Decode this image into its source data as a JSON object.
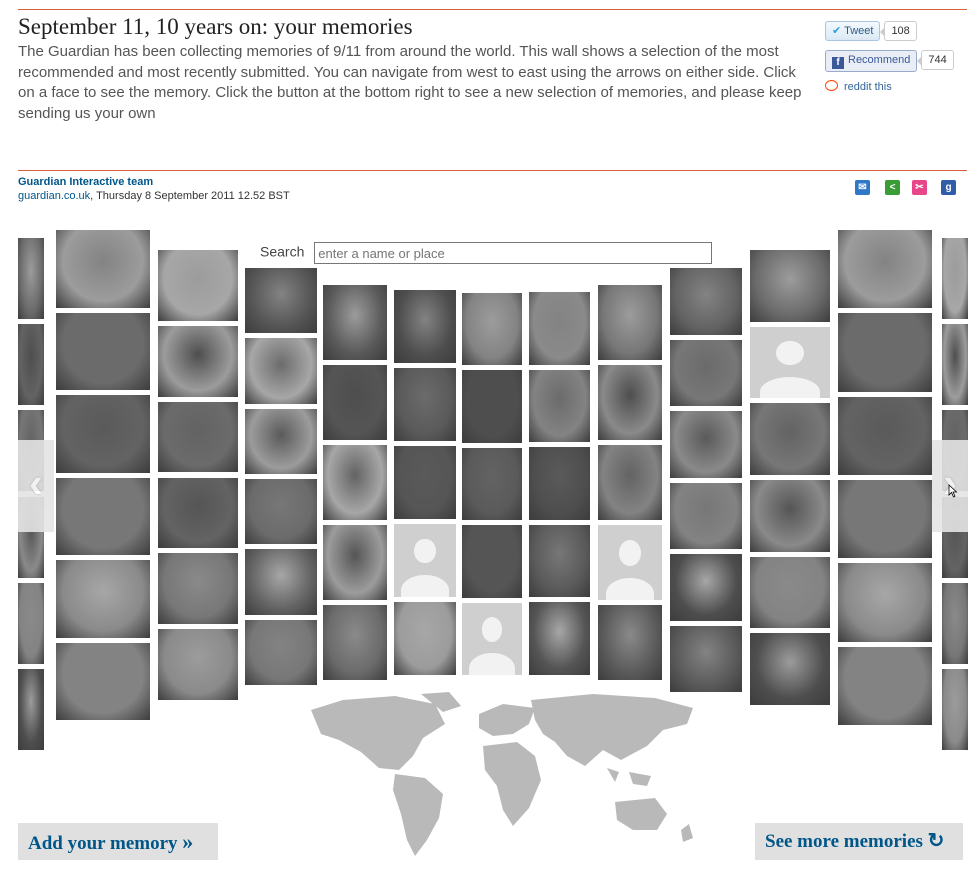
{
  "article": {
    "title": "September 11, 10 years on: your memories",
    "intro": "The Guardian has been collecting memories of 9/11 from around the world. This wall shows a selection of the most recommended and most recently submitted. You can navigate from west to east using the arrows on either side. Click on a face to see the memory. Click the button at the bottom right to see a new selection of memories, and please keep sending us your own"
  },
  "share": {
    "tweet_label": "Tweet",
    "tweet_count": "108",
    "recommend_label": "Recommend",
    "recommend_count": "744",
    "reddit_label": "reddit this"
  },
  "byline": {
    "author": "Guardian Interactive team",
    "source": "guardian.co.uk",
    "date": ", Thursday 8 September 2011 12.52 BST"
  },
  "social_icons": [
    "email-icon",
    "share-icon",
    "flickr-icon",
    "google-icon"
  ],
  "search": {
    "label": "Search",
    "placeholder": "enter a name or place"
  },
  "nav": {
    "prev_glyph": "‹",
    "next_glyph": "›"
  },
  "buttons": {
    "add_memory": "Add your memory",
    "add_memory_icon": "»",
    "see_more": "See more memories",
    "see_more_icon": "↻"
  },
  "colors": {
    "rule": "#d9613b",
    "guardian_blue": "#005689",
    "email": "#2f77c7",
    "share": "#3a9c35",
    "flickr": "#e8468a",
    "google": "#2f5da8"
  }
}
